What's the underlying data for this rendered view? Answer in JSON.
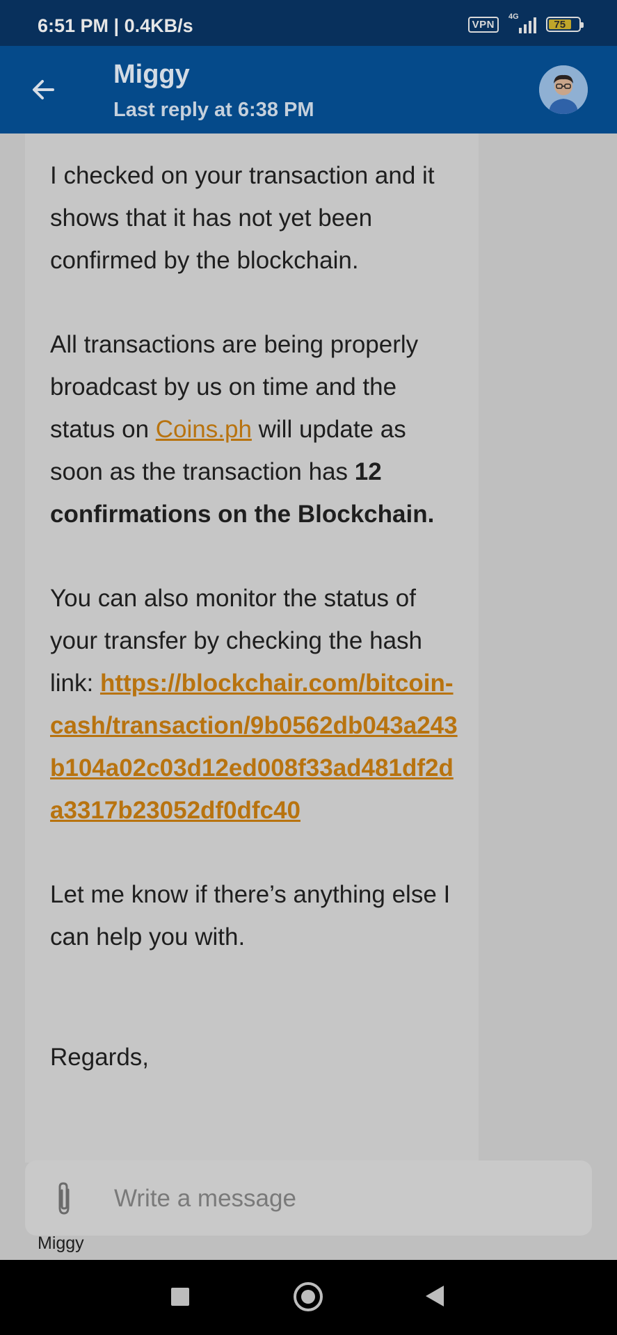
{
  "status_bar": {
    "time": "6:51 PM | 0.4KB/s",
    "vpn": "VPN",
    "network": "4G",
    "battery": "75"
  },
  "header": {
    "title": "Miggy",
    "subtitle": "Last reply at 6:38 PM"
  },
  "message": {
    "p1": "I checked on your transaction and it shows that it has not yet been confirmed by the blockchain.",
    "p2_a": "All transactions are being properly broadcast by us on time and the status on ",
    "p2_link": "Coins.ph",
    "p2_b": " will update as soon as the transaction has ",
    "p2_bold": "12 confirmations on the Blockchain.",
    "p3_a": "You can also monitor the status of your transfer by checking the hash link: ",
    "p3_link": "https://blockchair.com/bitcoin-cash/transaction/9b0562db043a243b104a02c03d12ed008f33ad481df2da3317b23052df0dfc40",
    "p4": "Let me know if there’s anything else I can help you with.",
    "p5": "Regards,"
  },
  "composer": {
    "placeholder": "Write a message",
    "sender_label": "Miggy"
  },
  "colors": {
    "header_bg": "#054a8a",
    "status_bg": "#08305c",
    "link": "#b8730f"
  }
}
